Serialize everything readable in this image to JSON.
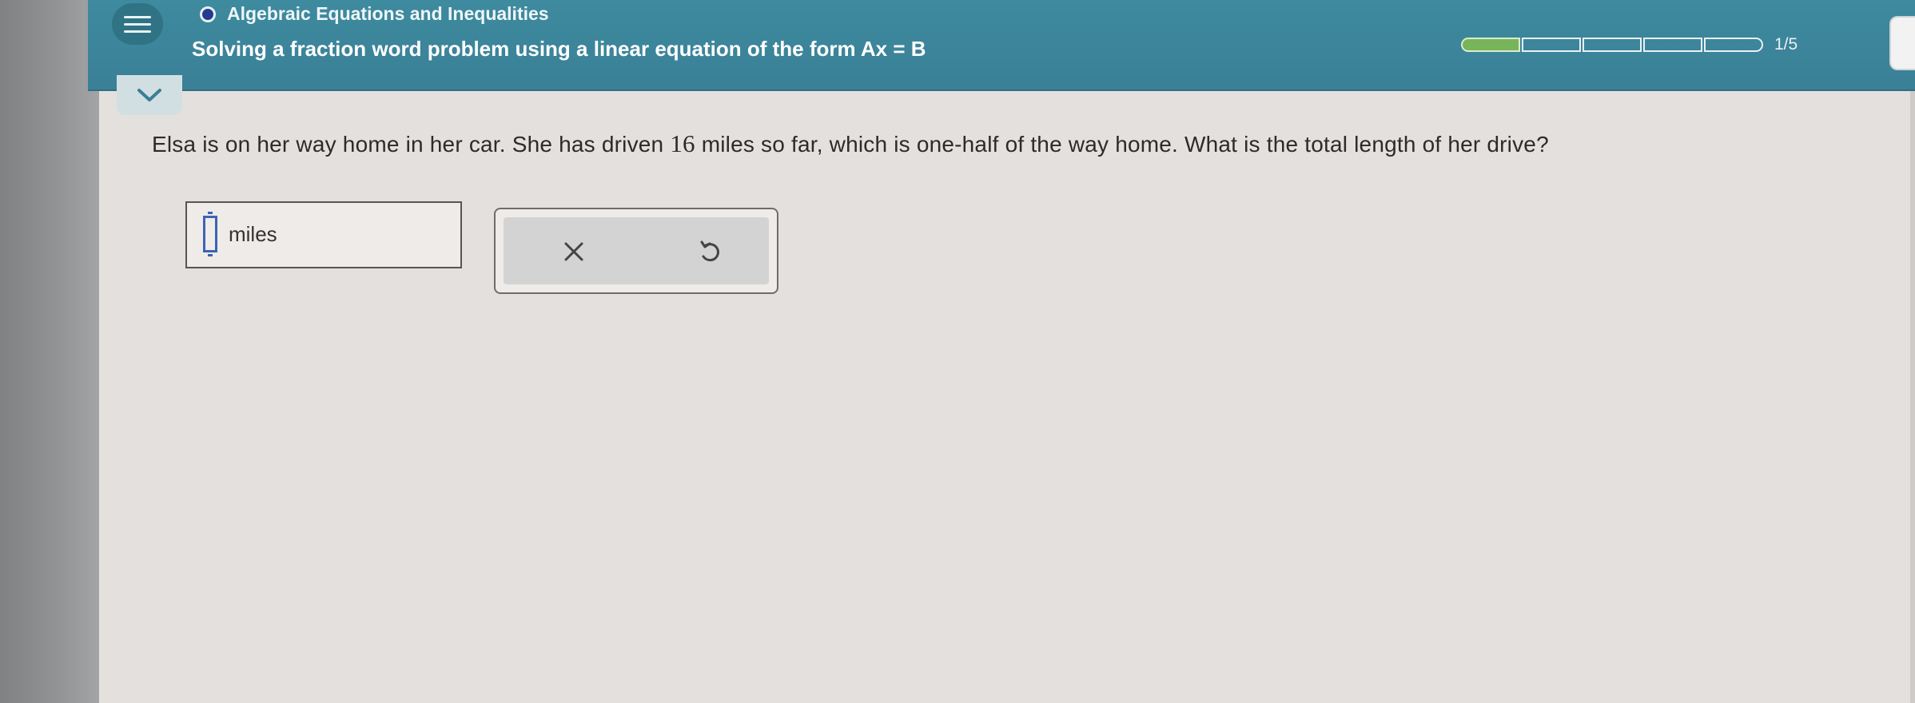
{
  "header": {
    "topic": "Algebraic Equations and Inequalities",
    "lesson_title": "Solving a fraction word problem using a linear equation of the form Ax = B",
    "progress": {
      "current": 1,
      "total": 5,
      "label": "1/5"
    }
  },
  "question": {
    "text_before_number": "Elsa is on her way home in her car. She has driven ",
    "number": "16",
    "text_after_number": " miles so far, which is one-half of the way home. What is the total length of her drive?"
  },
  "answer": {
    "value": "",
    "unit_label": "miles"
  },
  "actions": {
    "clear_icon": "x-icon",
    "undo_icon": "undo-icon"
  },
  "icons": {
    "menu": "hamburger-menu-icon",
    "collapse": "chevron-down-icon",
    "topic": "topic-dot-icon",
    "cursor": "input-cursor-icon"
  },
  "colors": {
    "header_bg": "#3e8a9f",
    "progress_filled": "#78b45a",
    "cursor_blue": "#3c63b5",
    "topic_dot": "#243b8f"
  }
}
